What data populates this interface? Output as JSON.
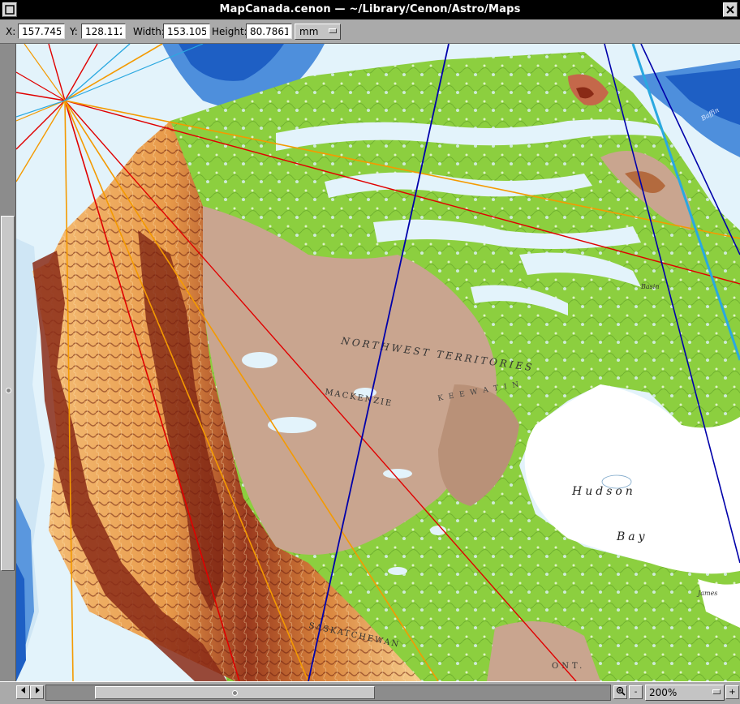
{
  "window": {
    "title": "MapCanada.cenon  —  ~/Library/Cenon/Astro/Maps"
  },
  "coords": {
    "x_label": "X:",
    "x_value": "157.745",
    "y_label": "Y:",
    "y_value": "128.112",
    "width_label": "Width:",
    "width_value": "153.105",
    "height_label": "Height:",
    "height_value": "80.7861",
    "unit": "mm"
  },
  "map": {
    "labels": {
      "hudson": "Hudson",
      "bay": "Bay",
      "mackenzie": "MACKENZIE",
      "territories": "NORTHWEST TERRITORIES",
      "saskatchewan": "SASKATCHEWAN",
      "ont": "ONT.",
      "james": "James",
      "keewatin": "K E E W A T I N",
      "baffin": "Baffin",
      "basin": "Basin"
    },
    "colors": {
      "ocean_deep": "#1e5fc4",
      "ocean_mid": "#4e8fdc",
      "ocean_light": "#e3f3fb",
      "lowland": "#8ccf3f",
      "highland": "#c9a58f",
      "mountain_orange": "#f1b15a",
      "mountain_red": "#8a2a16",
      "line_red": "#e00000",
      "line_orange": "#f49a00",
      "line_blue": "#0000aa",
      "line_cyan": "#2aa8e0"
    }
  },
  "statusbar": {
    "zoom_out_label": "-",
    "zoom_value": "200%",
    "zoom_in_label": "+"
  }
}
